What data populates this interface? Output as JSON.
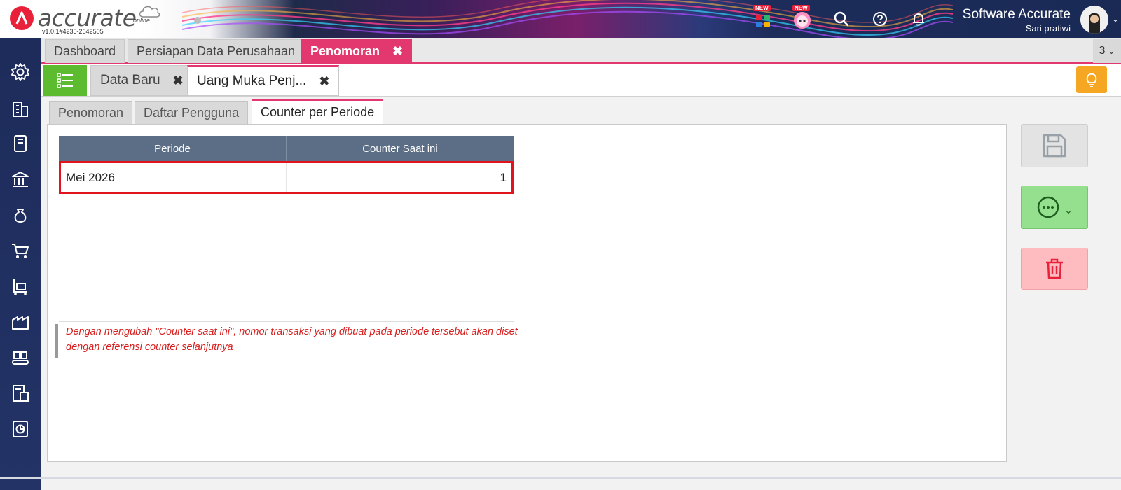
{
  "app": {
    "logo_text": "accurate",
    "logo_sub": "online",
    "version": "v1.0.1#4235-2642505"
  },
  "header": {
    "apps_badge": "NEW",
    "assistant_badge": "NEW",
    "company": "Software Accurate",
    "user": "Sari pratiwi"
  },
  "main_tabs": [
    {
      "label": "Dashboard"
    },
    {
      "label": "Persiapan Data Perusahaan"
    },
    {
      "label": "Penomoran"
    }
  ],
  "open_count": "3",
  "sub_tabs": [
    {
      "label": "Data Baru"
    },
    {
      "label": "Uang Muka Penj..."
    }
  ],
  "form_tabs": [
    {
      "label": "Penomoran"
    },
    {
      "label": "Daftar Pengguna"
    },
    {
      "label": "Counter per Periode"
    }
  ],
  "grid": {
    "columns": [
      "Periode",
      "Counter Saat ini"
    ],
    "rows": [
      {
        "periode": "Mei 2026",
        "counter": "1"
      }
    ]
  },
  "note": "Dengan mengubah \"Counter saat ini\", nomor transaksi yang dibuat pada periode tersebut akan diset dengan referensi counter selanjutnya",
  "colors": {
    "accent": "#e3376f",
    "green": "#5cbb2f",
    "header_bg": "#5b6e86",
    "highlight": "#e0141e",
    "note": "#d81e1e"
  }
}
